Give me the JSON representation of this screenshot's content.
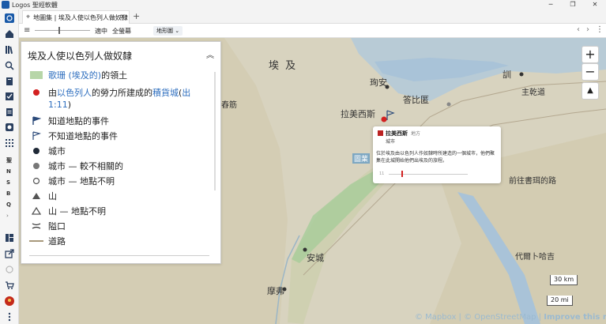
{
  "app": {
    "title": "Logos 聖經軟體"
  },
  "window_controls": {
    "minimize": "─",
    "restore": "❐",
    "close": "✕"
  },
  "tab": {
    "label": "地圖集 | 埃及人使以色列人做奴隸",
    "close": "✕",
    "new_tab": "+"
  },
  "toolbar": {
    "menu_icon": "≡",
    "fit_label": "適中",
    "fullscreen_label": "全螢幕",
    "map_type": "地形圖",
    "map_type_caret": "⌄",
    "back_icon": "‹",
    "forward_icon": "›",
    "more_icon": "⋮"
  },
  "sidebar": {
    "icons": [
      "logos-icon",
      "home-icon",
      "library-icon",
      "search-icon",
      "bookmark-icon",
      "checklist-icon",
      "document-icon",
      "lens-icon",
      "apps-icon"
    ],
    "letters": [
      "聖",
      "N",
      "S",
      "B",
      "Q"
    ],
    "chevron": "›",
    "bottom_icons": [
      "layout-icon",
      "export-icon",
      "sync-icon",
      "cart-icon",
      "avatar-icon",
      "more-icon"
    ]
  },
  "legend": {
    "title": "埃及人使以色列人做奴隸",
    "collapse": "︽",
    "items": [
      {
        "symbol": "area",
        "parts": [
          {
            "t": "歌珊 (埃及的)",
            "link": true
          },
          {
            "t": "的領土",
            "link": false
          }
        ]
      },
      {
        "symbol": "red-dot",
        "parts": [
          {
            "t": "由",
            "link": false
          },
          {
            "t": "以色列人",
            "link": true
          },
          {
            "t": "的勞力所建成的",
            "link": false
          },
          {
            "t": "積貨城",
            "link": true
          },
          {
            "t": " (",
            "link": false
          },
          {
            "t": "出",
            "link": true
          }
        ]
      },
      {
        "symbol": "none",
        "parts": [
          {
            "t": "1:11",
            "link": true
          },
          {
            "t": ")",
            "link": false
          }
        ]
      },
      {
        "symbol": "flag-dark",
        "parts": [
          {
            "t": "知道地點的事件",
            "link": false
          }
        ]
      },
      {
        "symbol": "flag-light",
        "parts": [
          {
            "t": "不知道地點的事件",
            "link": false
          }
        ]
      },
      {
        "symbol": "city",
        "parts": [
          {
            "t": "城市",
            "link": false
          }
        ]
      },
      {
        "symbol": "city-grey",
        "parts": [
          {
            "t": "城市 — 較不相關的",
            "link": false
          }
        ]
      },
      {
        "symbol": "city-hollow",
        "parts": [
          {
            "t": "城市 — 地點不明",
            "link": false
          }
        ]
      },
      {
        "symbol": "mountain",
        "parts": [
          {
            "t": "山",
            "link": false
          }
        ]
      },
      {
        "symbol": "mountain-hollow",
        "parts": [
          {
            "t": "山 — 地點不明",
            "link": false
          }
        ]
      },
      {
        "symbol": "pass",
        "parts": [
          {
            "t": "隘口",
            "link": false
          }
        ]
      },
      {
        "symbol": "road",
        "parts": [
          {
            "t": "道路",
            "link": false
          }
        ]
      }
    ]
  },
  "map_labels": {
    "egypt": "埃 及",
    "pithom_area": "珣安",
    "ramses": "拉美西斯",
    "succoth": "答比匿",
    "migdol": "訓",
    "sea": "主乾道",
    "wilderness": "前往書珥的路",
    "on": "安城",
    "memphis": "摩弗",
    "paddan": "代爾卜哈吉",
    "westlabel": "舂筋",
    "goshen_short": "圖業"
  },
  "popup": {
    "title": "拉美西斯",
    "type": "地方",
    "subtitle": "城市",
    "description": "位於埃及由以色列人作奴隸時所建造的一個城市，他們聚集在此城開始他們出埃及的旅程。",
    "track_label": "11"
  },
  "map_controls": {
    "zoom_in": "+",
    "zoom_out": "−",
    "compass": "▲"
  },
  "scale": {
    "km": "30 km",
    "mi": "20 mi"
  },
  "attribution": {
    "mapbox": "© Mapbox",
    "osm": "© OpenStreetMap",
    "improve": "Improve this map",
    "sep": " | "
  },
  "colors": {
    "water": "#a9c3d8",
    "land": "#d9d4c1",
    "goshen": "#a9cc9b",
    "link": "#2f6fbf",
    "accent": "#1a5aa8"
  }
}
